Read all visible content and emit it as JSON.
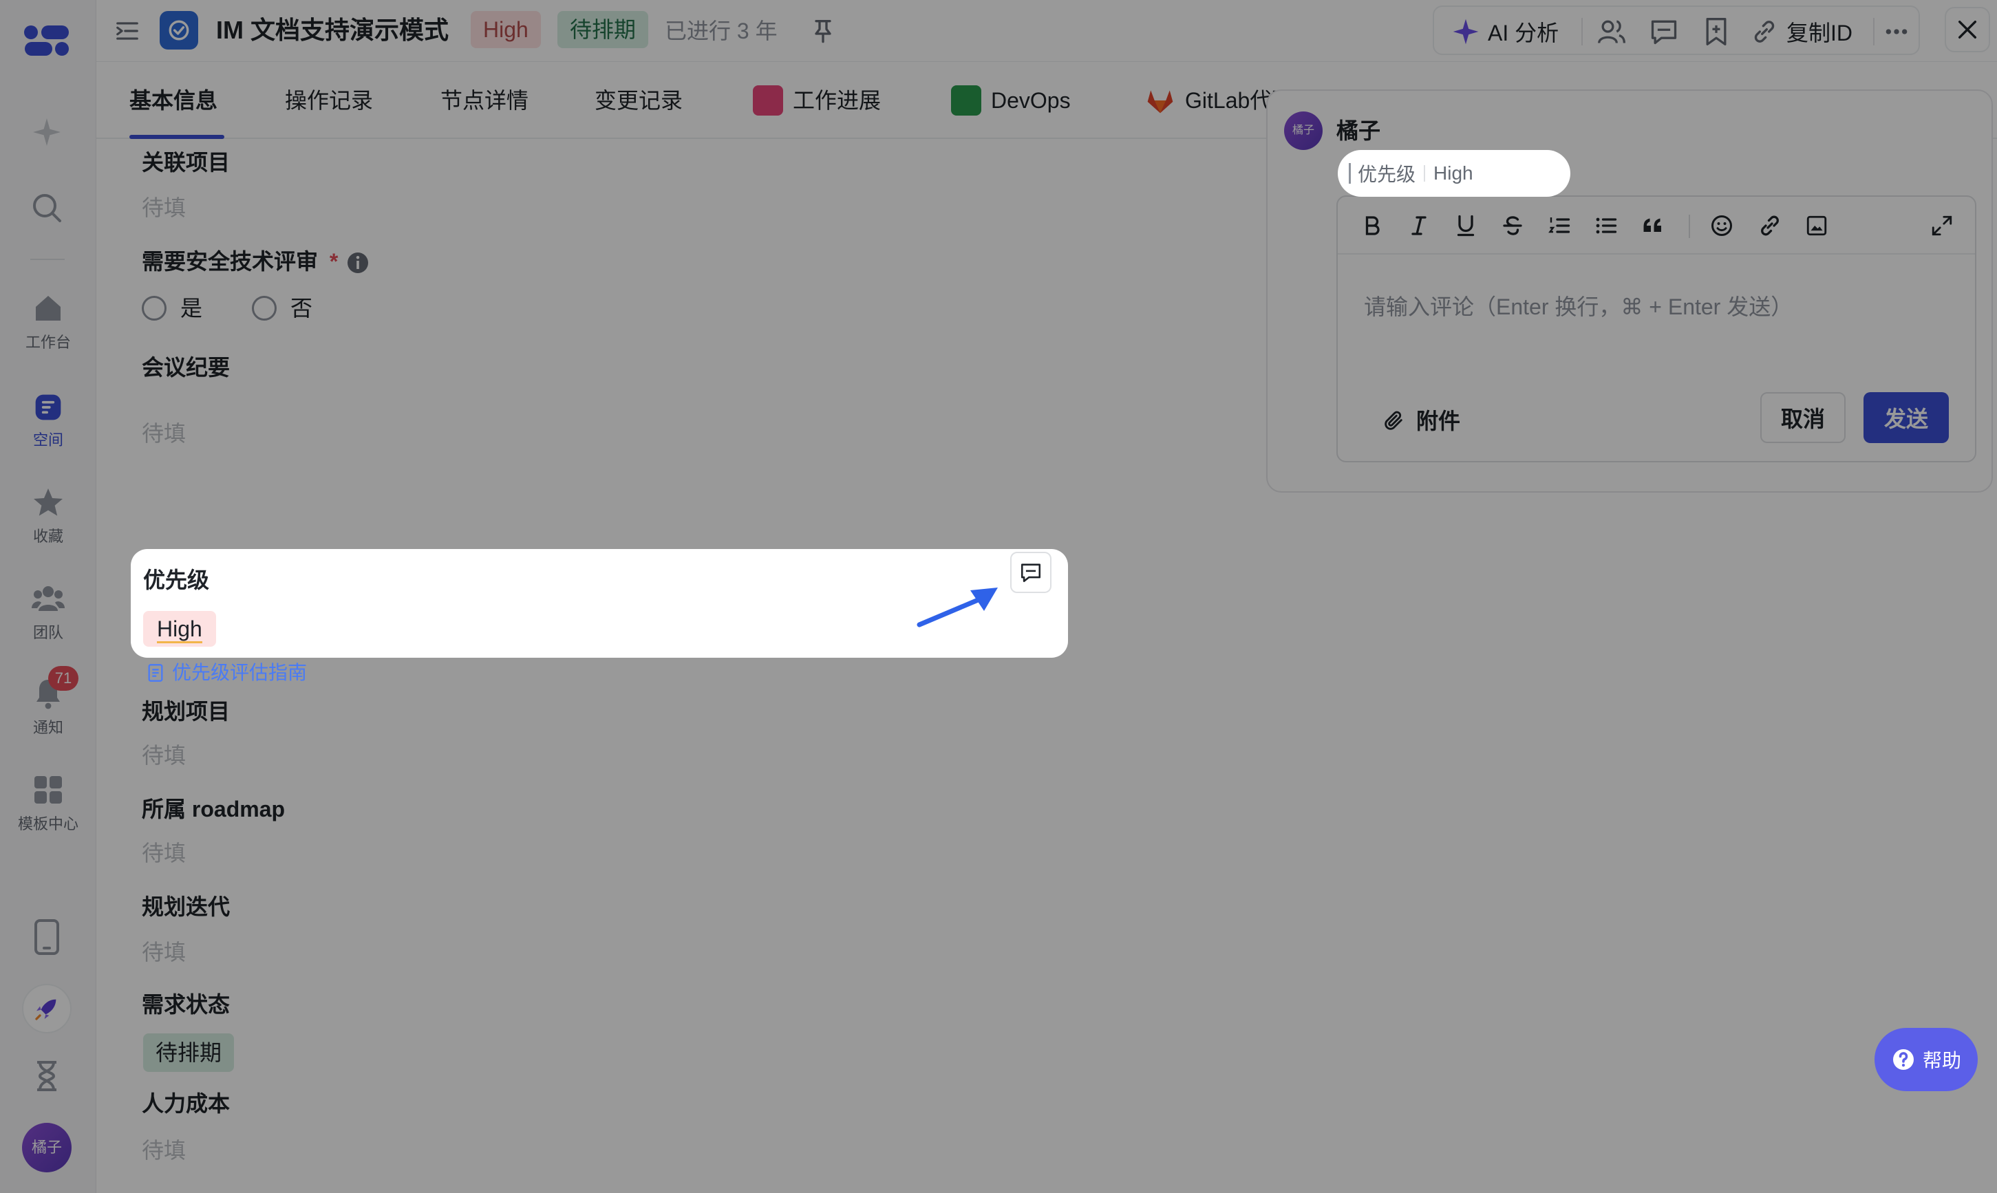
{
  "sidebar": {
    "items": [
      {
        "label": "工作台",
        "icon": "home-icon"
      },
      {
        "label": "空间",
        "icon": "space-icon"
      },
      {
        "label": "收藏",
        "icon": "star-icon"
      },
      {
        "label": "团队",
        "icon": "team-icon"
      },
      {
        "label": "通知",
        "icon": "bell-icon"
      },
      {
        "label": "模板中心",
        "icon": "template-icon"
      }
    ],
    "notification_count": "71",
    "avatar_text": "橘子"
  },
  "header": {
    "title": "IM 文档支持演示模式",
    "priority_tag": "High",
    "status_tag": "待排期",
    "elapsed": "已进行 3 年",
    "ai_label": "AI 分析",
    "copy_id_label": "复制ID"
  },
  "tabs": [
    {
      "label": "基本信息"
    },
    {
      "label": "操作记录"
    },
    {
      "label": "节点详情"
    },
    {
      "label": "变更记录"
    },
    {
      "label": "工作进展"
    },
    {
      "label": "DevOps"
    },
    {
      "label": "GitLab代码仓库"
    }
  ],
  "fields": {
    "related_project": {
      "label": "关联项目",
      "value": "待填"
    },
    "security_review": {
      "label": "需要安全技术评审",
      "required_mark": "*",
      "options": [
        "是",
        "否"
      ]
    },
    "meeting_notes": {
      "label": "会议纪要",
      "value": "待填"
    },
    "priority": {
      "label": "优先级",
      "value": "High",
      "guide": "优先级评估指南"
    },
    "planned_project": {
      "label": "规划项目",
      "value": "待填"
    },
    "roadmap": {
      "label": "所属 roadmap",
      "value": "待填"
    },
    "iteration": {
      "label": "规划迭代",
      "value": "待填"
    },
    "req_status": {
      "label": "需求状态",
      "value": "待排期"
    },
    "labor_cost": {
      "label": "人力成本",
      "value": "待填"
    }
  },
  "comment": {
    "user_name": "橘子",
    "avatar_text": "橘子",
    "quote_field": "优先级",
    "quote_value": "High",
    "placeholder": "请输入评论（Enter 换行，⌘ + Enter 发送）",
    "attach_label": "附件",
    "cancel_label": "取消",
    "send_label": "发送"
  },
  "help_label": "帮助",
  "colors": {
    "accent": "#3b4fd4",
    "high_tag_bg": "#fde2e2",
    "status_tag_bg": "#d6ede1",
    "link": "#4a7bf5"
  }
}
